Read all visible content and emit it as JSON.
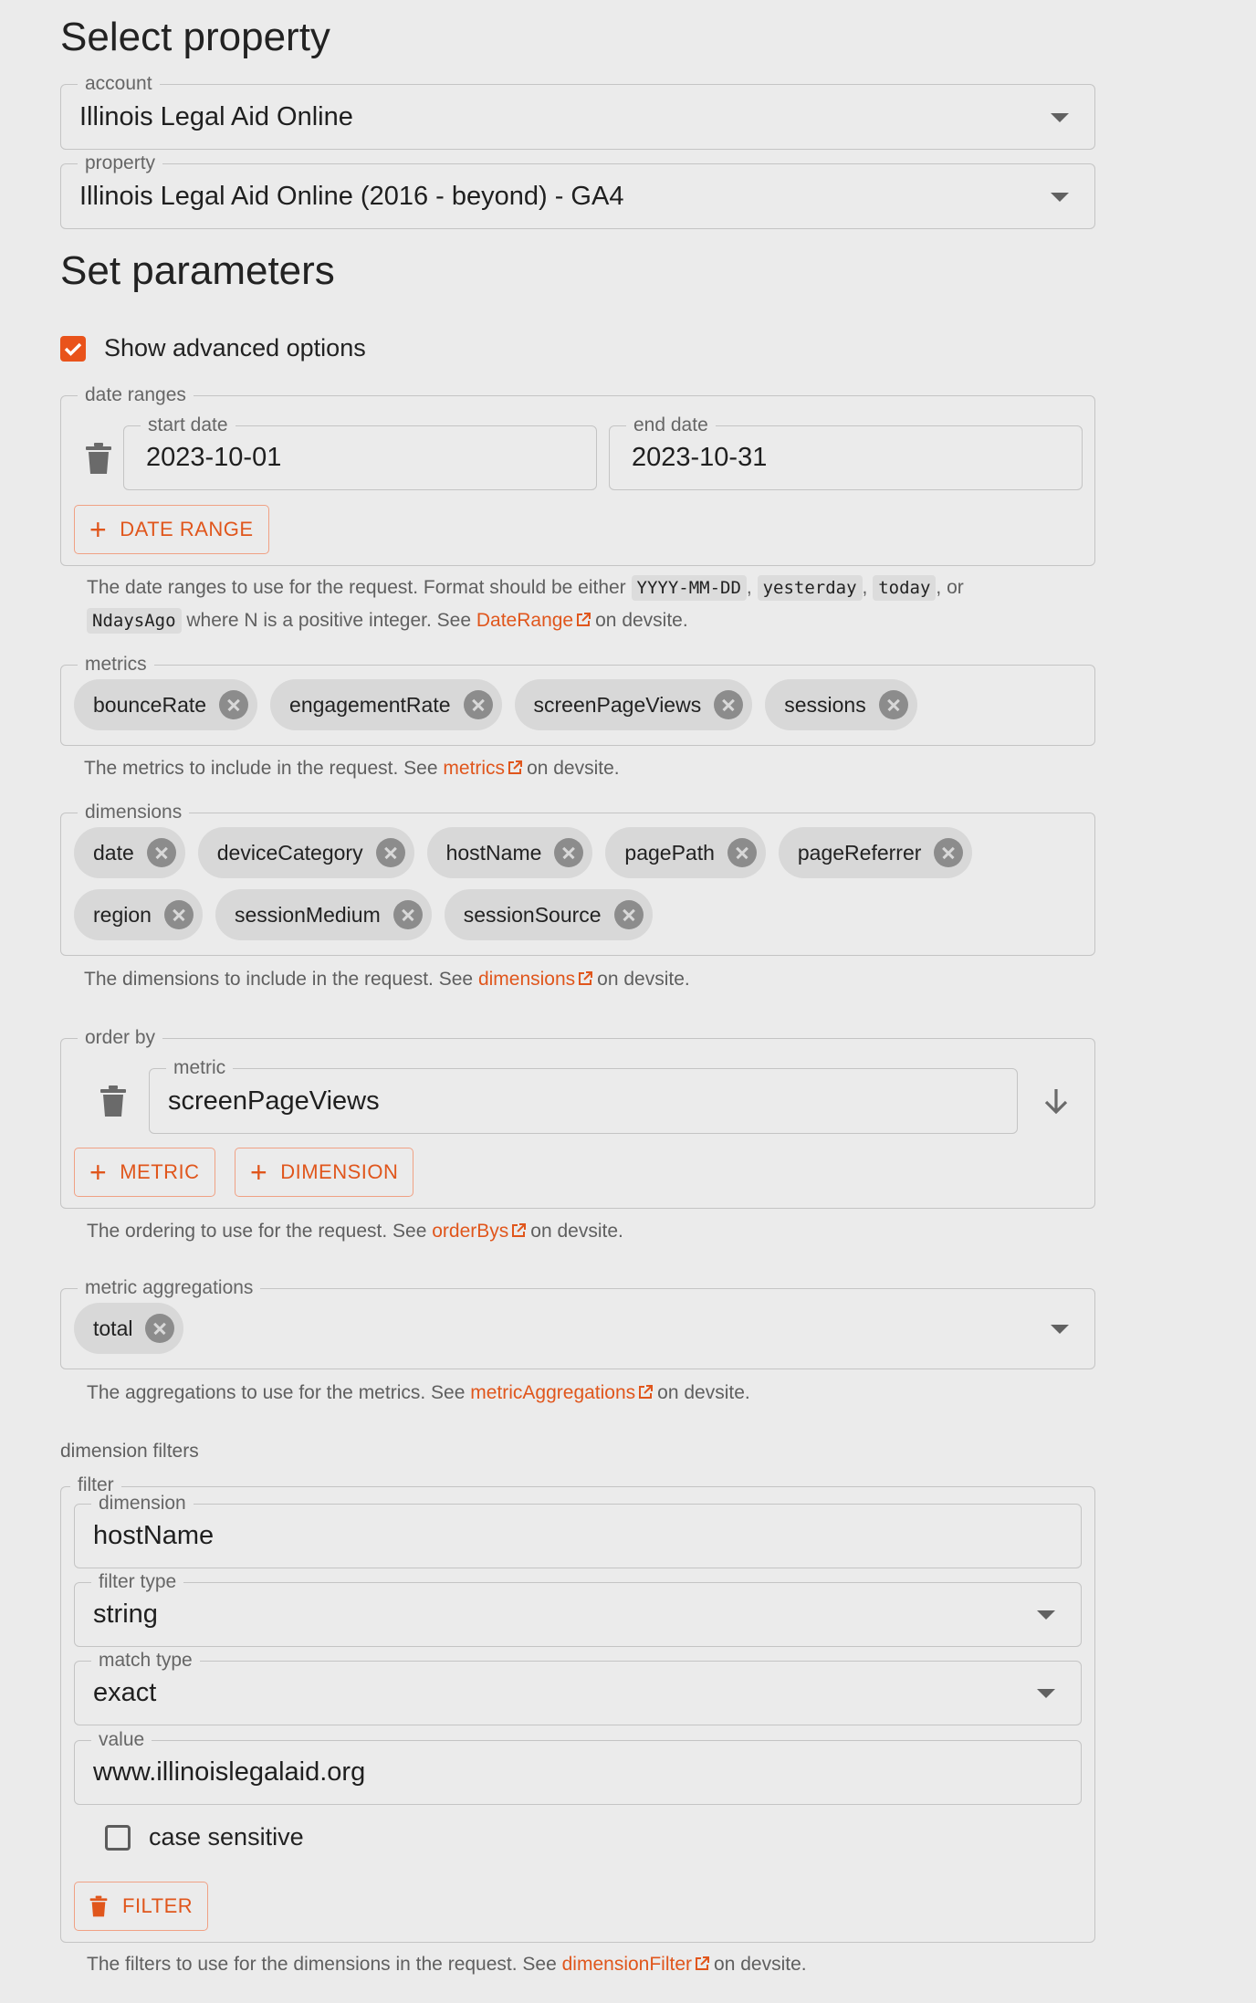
{
  "select_property": {
    "title": "Select property",
    "account": {
      "label": "account",
      "value": "Illinois Legal Aid Online"
    },
    "property": {
      "label": "property",
      "value": "Illinois Legal Aid Online (2016 - beyond) - GA4"
    }
  },
  "set_parameters": {
    "title": "Set parameters",
    "advanced_label": "Show advanced options",
    "advanced_checked": true
  },
  "date_ranges": {
    "legend": "date ranges",
    "start_label": "start date",
    "start_value": "2023-10-01",
    "end_label": "end date",
    "end_value": "2023-10-31",
    "add_button": "DATE RANGE",
    "help_1": "The date ranges to use for the request. Format should be either",
    "code_1": "YYYY-MM-DD",
    "code_2": "yesterday",
    "code_3": "today",
    "help_or": ", or",
    "code_4": "NdaysAgo",
    "help_2": "where N is a positive integer. See",
    "link": "DateRange",
    "help_3": "on devsite."
  },
  "metrics": {
    "legend": "metrics",
    "chips": [
      "bounceRate",
      "engagementRate",
      "screenPageViews",
      "sessions"
    ],
    "help": "The metrics to include in the request. See",
    "link": "metrics",
    "help_end": "on devsite."
  },
  "dimensions": {
    "legend": "dimensions",
    "chips": [
      "date",
      "deviceCategory",
      "hostName",
      "pagePath",
      "pageReferrer",
      "region",
      "sessionMedium",
      "sessionSource"
    ],
    "help": "The dimensions to include in the request. See",
    "link": "dimensions",
    "help_end": "on devsite."
  },
  "order_by": {
    "legend": "order by",
    "metric_label": "metric",
    "metric_value": "screenPageViews",
    "add_metric": "METRIC",
    "add_dimension": "DIMENSION",
    "help": "The ordering to use for the request. See",
    "link": "orderBys",
    "help_end": "on devsite."
  },
  "metric_aggregations": {
    "legend": "metric aggregations",
    "chips": [
      "total"
    ],
    "help": "The aggregations to use for the metrics. See",
    "link": "metricAggregations",
    "help_end": "on devsite."
  },
  "dimension_filters": {
    "title": "dimension filters",
    "legend": "filter",
    "dimension_label": "dimension",
    "dimension_value": "hostName",
    "filter_type_label": "filter type",
    "filter_type_value": "string",
    "match_type_label": "match type",
    "match_type_value": "exact",
    "value_label": "value",
    "value_value": "www.illinoislegalaid.org",
    "case_label": "case sensitive",
    "case_checked": false,
    "remove_button": "FILTER",
    "help": "The filters to use for the dimensions in the request. See",
    "link": "dimensionFilter",
    "help_end": "on devsite."
  }
}
